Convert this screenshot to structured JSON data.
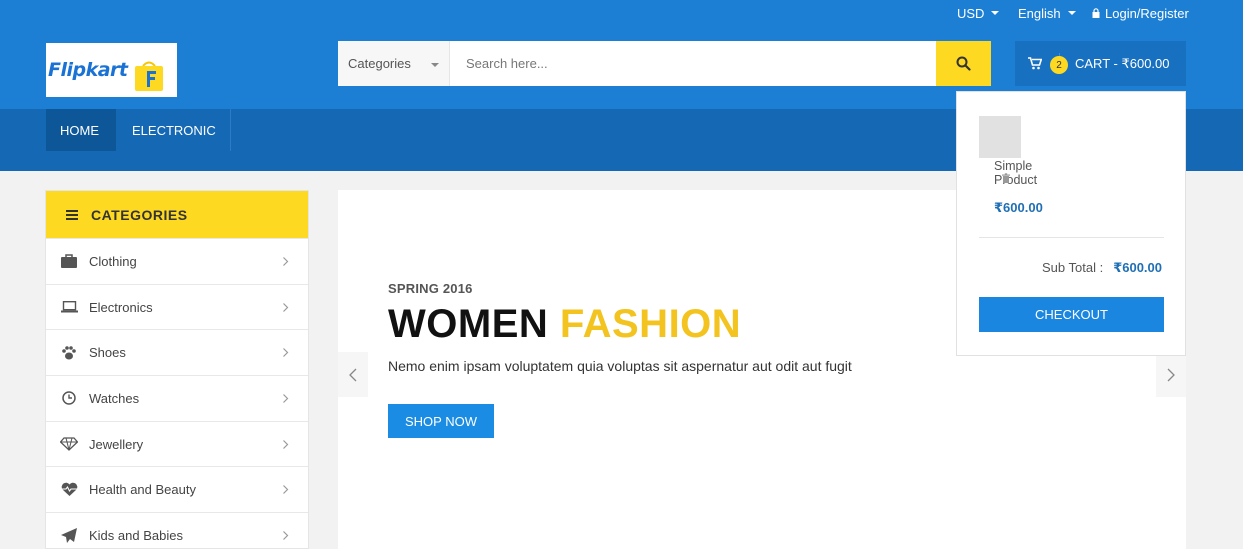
{
  "topbar": {
    "currency": "USD",
    "language": "English",
    "login": "Login/Register"
  },
  "brand": {
    "logo_text": "Flipkart"
  },
  "search": {
    "category": "Categories",
    "placeholder": "Search here..."
  },
  "cart": {
    "count": "2",
    "label": "CART - ₹600.00"
  },
  "nav": {
    "items": [
      {
        "label": "HOME"
      },
      {
        "label": "ELECTRONIC"
      }
    ]
  },
  "sidebar": {
    "title": "CATEGORIES",
    "items": [
      {
        "label": "Clothing",
        "icon": "briefcase-icon"
      },
      {
        "label": "Electronics",
        "icon": "laptop-icon"
      },
      {
        "label": "Shoes",
        "icon": "paw-icon"
      },
      {
        "label": "Watches",
        "icon": "clock-icon"
      },
      {
        "label": "Jewellery",
        "icon": "diamond-icon"
      },
      {
        "label": "Health and Beauty",
        "icon": "heartbeat-icon"
      },
      {
        "label": "Kids and Babies",
        "icon": "paper-plane-icon"
      }
    ]
  },
  "slide": {
    "eyebrow": "SPRING 2016",
    "title_1": "WOMEN",
    "title_2": "FASHION",
    "description": "Nemo enim ipsam voluptatem quia voluptas sit aspernatur aut odit aut fugit",
    "button": "SHOP NOW"
  },
  "cart_dropdown": {
    "product_name": "Simple Product",
    "product_price": "₹600.00",
    "subtotal_label": "Sub Total :",
    "subtotal_value": "₹600.00",
    "checkout": "CHECKOUT"
  },
  "colors": {
    "header": "#1d7fd4",
    "nav": "#1568b3",
    "accent_yellow": "#fdd922",
    "button_blue": "#1b8ce3"
  }
}
